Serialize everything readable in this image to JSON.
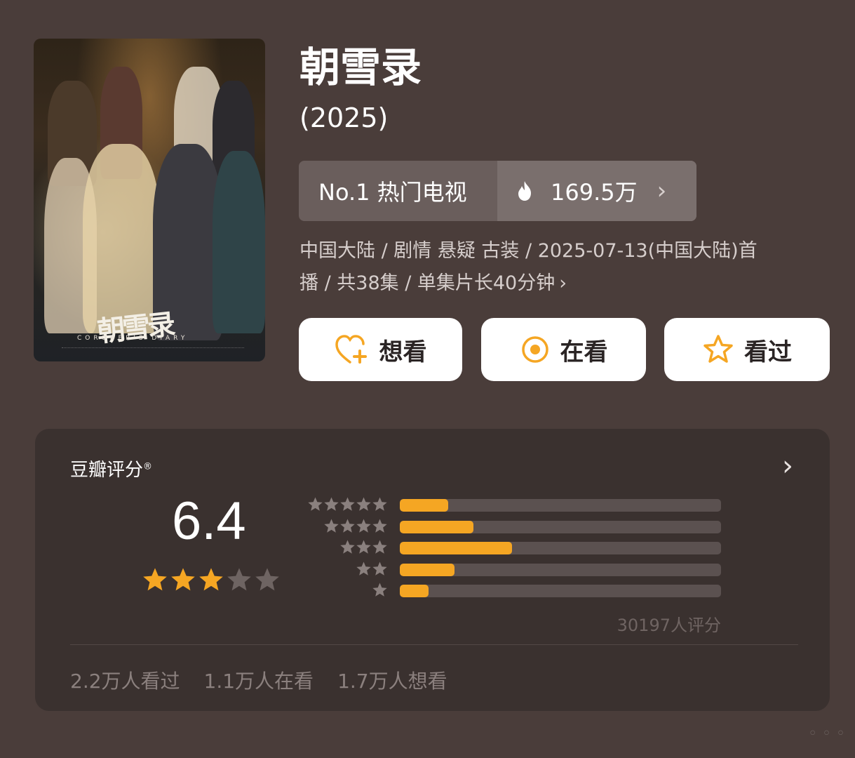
{
  "show": {
    "title": "朝雪录",
    "year": "(2025)",
    "poster_title": "朝雪录",
    "poster_subtitle": "CORONER'S DIARY"
  },
  "rank": {
    "label": "No.1 热门电视",
    "heat": "169.5万"
  },
  "meta": {
    "line1": "中国大陆 / 剧情 悬疑 古装 / 2025-07-13(中国大陆)首",
    "line2": "播 / 共38集 / 单集片长40分钟"
  },
  "buttons": {
    "want": "想看",
    "watching": "在看",
    "watched": "看过"
  },
  "rating": {
    "label": "豆瓣评分",
    "registered": "®",
    "score": "6.4",
    "stars_filled": 3,
    "stars_total": 5,
    "votes": "30197人评分",
    "distribution": [
      {
        "stars": 5,
        "fraction": 0.15
      },
      {
        "stars": 4,
        "fraction": 0.23
      },
      {
        "stars": 3,
        "fraction": 0.35
      },
      {
        "stars": 2,
        "fraction": 0.17
      },
      {
        "stars": 1,
        "fraction": 0.09
      }
    ]
  },
  "stats": {
    "watched": "2.2万人看过",
    "watching": "1.1万人在看",
    "want": "1.7万人想看"
  },
  "colors": {
    "background": "#4a3d3a",
    "card": "#3a312f",
    "accent": "#f5a623",
    "bar_track": "#5b5150"
  },
  "icons": {
    "flame": "flame-icon",
    "heart_plus": "heart-plus-icon",
    "target": "target-icon",
    "star": "star-icon",
    "chevron": "chevron-right-icon"
  }
}
